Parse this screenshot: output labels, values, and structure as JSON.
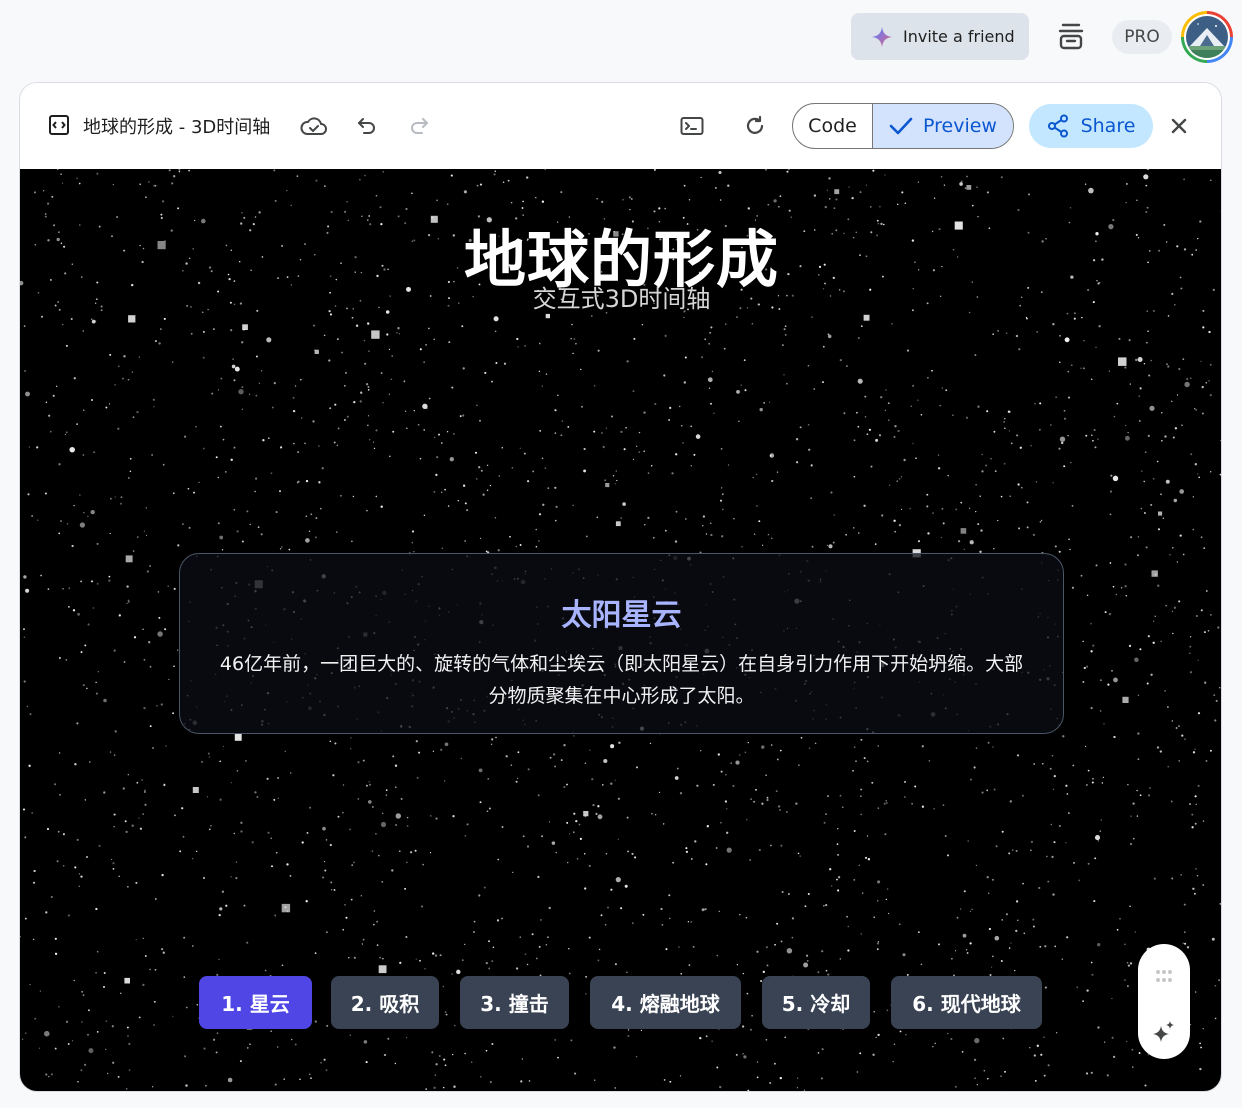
{
  "topbar": {
    "invite_label": "Invite a friend",
    "pro_label": "PRO"
  },
  "toolbar": {
    "doc_title": "地球的形成 - 3D时间轴",
    "code_label": "Code",
    "preview_label": "Preview",
    "share_label": "Share"
  },
  "preview": {
    "title": "地球的形成",
    "subtitle": "交互式3D时间轴",
    "card": {
      "heading": "太阳星云",
      "description": "46亿年前，一团巨大的、旋转的气体和尘埃云（即太阳星云）在自身引力作用下开始坍缩。大部分物质聚集在中心形成了太阳。"
    },
    "stages": [
      {
        "label": "1. 星云",
        "active": true
      },
      {
        "label": "2. 吸积",
        "active": false
      },
      {
        "label": "3. 撞击",
        "active": false
      },
      {
        "label": "4. 熔融地球",
        "active": false
      },
      {
        "label": "5. 冷却",
        "active": false
      },
      {
        "label": "6. 现代地球",
        "active": false
      }
    ]
  },
  "colors": {
    "accent": "#4f46e5",
    "stage_inactive": "#394353",
    "card_heading": "#a9b4ff",
    "share_bg": "#c2e7ff",
    "preview_selected_bg": "#d3e3fd"
  },
  "icons": {
    "invite": "sparkle-icon",
    "dock": "stack-icon",
    "toolbar_left": [
      "code-embed-icon",
      "cloud-save-icon",
      "undo-icon",
      "redo-icon"
    ],
    "toolbar_right": [
      "terminal-icon",
      "refresh-icon",
      "check-icon",
      "share-icon",
      "close-icon"
    ],
    "float": [
      "drag-handle-icon",
      "magic-sparkle-icon"
    ]
  }
}
